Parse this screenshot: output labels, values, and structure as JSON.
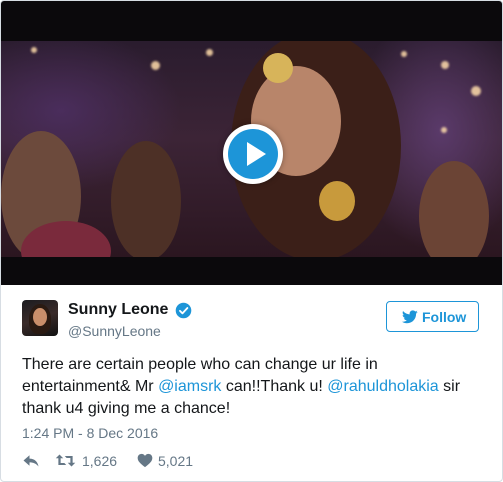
{
  "video": {
    "play_icon": "play-icon"
  },
  "tweet": {
    "avatar_icon": "avatar",
    "display_name": "Sunny Leone",
    "verified_icon": "verified-badge-icon",
    "handle": "@SunnyLeone",
    "follow_button": {
      "icon": "twitter-bird-icon",
      "label": "Follow"
    },
    "text": {
      "line1": "There are certain people who can change ur life in",
      "line2_prefix": "entertainment& Mr ",
      "mention1": "@iamsrk",
      "line2_mid": " can!!Thank u! ",
      "mention2": "@rahuldholakia",
      "line2_suffix": " sir",
      "line3": "thank u4 giving me a chance!"
    },
    "timestamp": "1:24 PM - 8 Dec 2016",
    "actions": {
      "reply_icon": "reply-icon",
      "retweet_icon": "retweet-icon",
      "retweet_count": "1,626",
      "like_icon": "heart-icon",
      "like_count": "5,021"
    }
  },
  "colors": {
    "accent": "#1d95d8",
    "text": "#14171a",
    "muted": "#657786",
    "border": "#d7dde3"
  }
}
